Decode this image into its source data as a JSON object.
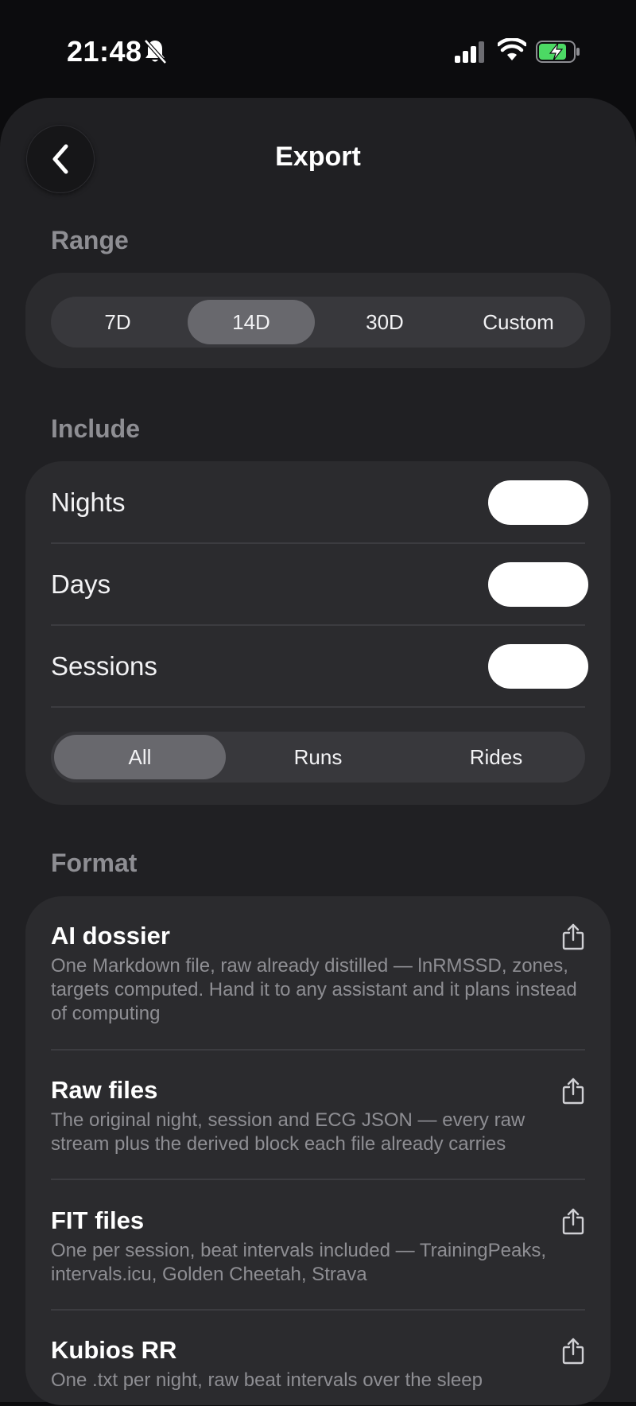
{
  "status_bar": {
    "time": "21:48",
    "icons": [
      "bell-slash-icon",
      "cellular-signal-icon",
      "wifi-icon",
      "battery-charging-icon"
    ],
    "battery_color": "#4cd964"
  },
  "header": {
    "title": "Export",
    "back_icon": "chevron-left-icon"
  },
  "range": {
    "label": "Range",
    "options": [
      "7D",
      "14D",
      "30D",
      "Custom"
    ],
    "selected": "14D"
  },
  "include": {
    "label": "Include",
    "toggles": [
      {
        "label": "Nights",
        "on": true
      },
      {
        "label": "Days",
        "on": true
      },
      {
        "label": "Sessions",
        "on": true
      }
    ],
    "session_filter": {
      "options": [
        "All",
        "Runs",
        "Rides"
      ],
      "selected": "All"
    }
  },
  "format": {
    "label": "Format",
    "items": [
      {
        "title": "AI dossier",
        "description": "One Markdown file, raw already distilled — lnRMSSD, zones, targets computed. Hand it to any assistant and it plans instead of computing",
        "icon": "share-icon"
      },
      {
        "title": "Raw files",
        "description": "The original night, session and ECG JSON — every raw stream plus the derived block each file already carries",
        "icon": "share-icon"
      },
      {
        "title": "FIT files",
        "description": "One per session, beat intervals included — TrainingPeaks, intervals.icu, Golden Cheetah, Strava",
        "icon": "share-icon"
      },
      {
        "title": "Kubios RR",
        "description": "One .txt per night, raw beat intervals over the sleep",
        "icon": "share-icon"
      }
    ]
  },
  "colors": {
    "background": "#0c0c0e",
    "sheet": "#202023",
    "card": "#2b2b2e",
    "segment_active": "#68686d",
    "secondary_text": "#8e8e93"
  }
}
